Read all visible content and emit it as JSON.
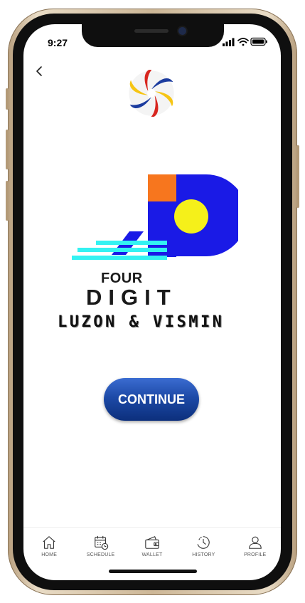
{
  "status_bar": {
    "time": "9:27"
  },
  "header": {
    "back_icon": "chevron-left-icon"
  },
  "branding": {
    "sponsor_logo": "pcso-logo",
    "game_logo": "4d-logo",
    "game_word": "FOUR",
    "game_title": "DIGIT",
    "game_region": "LUZON & VISMIN",
    "logo_colors": {
      "blue": "#1a1ae6",
      "orange": "#f7761e",
      "yellow": "#f5f01a",
      "cyan": "#33f2f2"
    }
  },
  "main": {
    "continue_label": "CONTINUE"
  },
  "nav": {
    "items": [
      {
        "label": "HOME",
        "icon": "home-icon"
      },
      {
        "label": "SCHEDULE",
        "icon": "calendar-icon"
      },
      {
        "label": "WALLET",
        "icon": "wallet-icon"
      },
      {
        "label": "HISTORY",
        "icon": "history-icon"
      },
      {
        "label": "PROFILE",
        "icon": "profile-icon"
      }
    ]
  }
}
